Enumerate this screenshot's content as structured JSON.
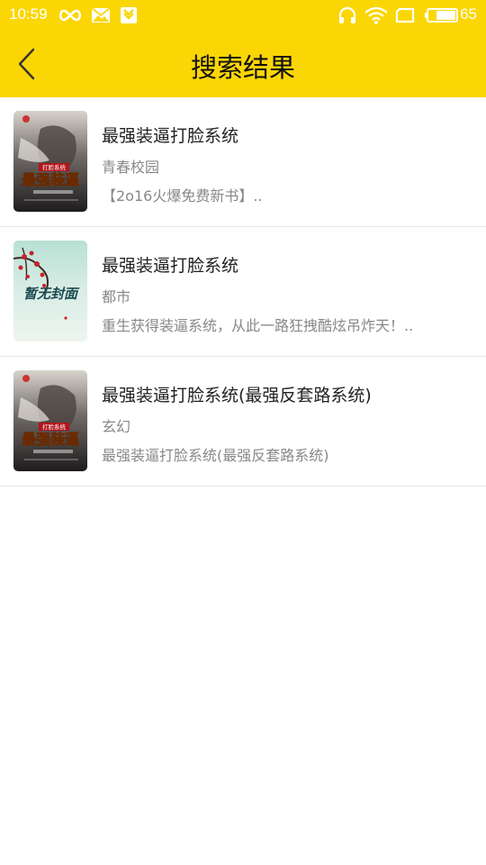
{
  "status": {
    "time": "10:59",
    "battery": "65",
    "icons": [
      "infinity-icon",
      "mail-icon",
      "download-icon",
      "headphones-icon",
      "wifi-icon",
      "sim-icon",
      "battery-icon"
    ]
  },
  "header": {
    "title": "搜索结果",
    "back_icon": "chevron-left-icon"
  },
  "colors": {
    "accent": "#FBD605"
  },
  "results": [
    {
      "title": "最强装逼打脸系统",
      "category": "青春校园",
      "desc": "【2o16火爆免费新书】..",
      "cover": "cover-art-default"
    },
    {
      "title": "最强装逼打脸系统",
      "category": "都市",
      "desc": "重生获得装逼系统，从此一路狂拽酷炫吊炸天！..",
      "cover": "cover-placeholder"
    },
    {
      "title": "最强装逼打脸系统(最强反套路系统)",
      "category": "玄幻",
      "desc": "最强装逼打脸系统(最强反套路系统)",
      "cover": "cover-art-default"
    }
  ],
  "cover_texts": {
    "cover_main": "最强装逼",
    "cover_tag": "打脸系统",
    "placeholder": "暂无封面"
  }
}
